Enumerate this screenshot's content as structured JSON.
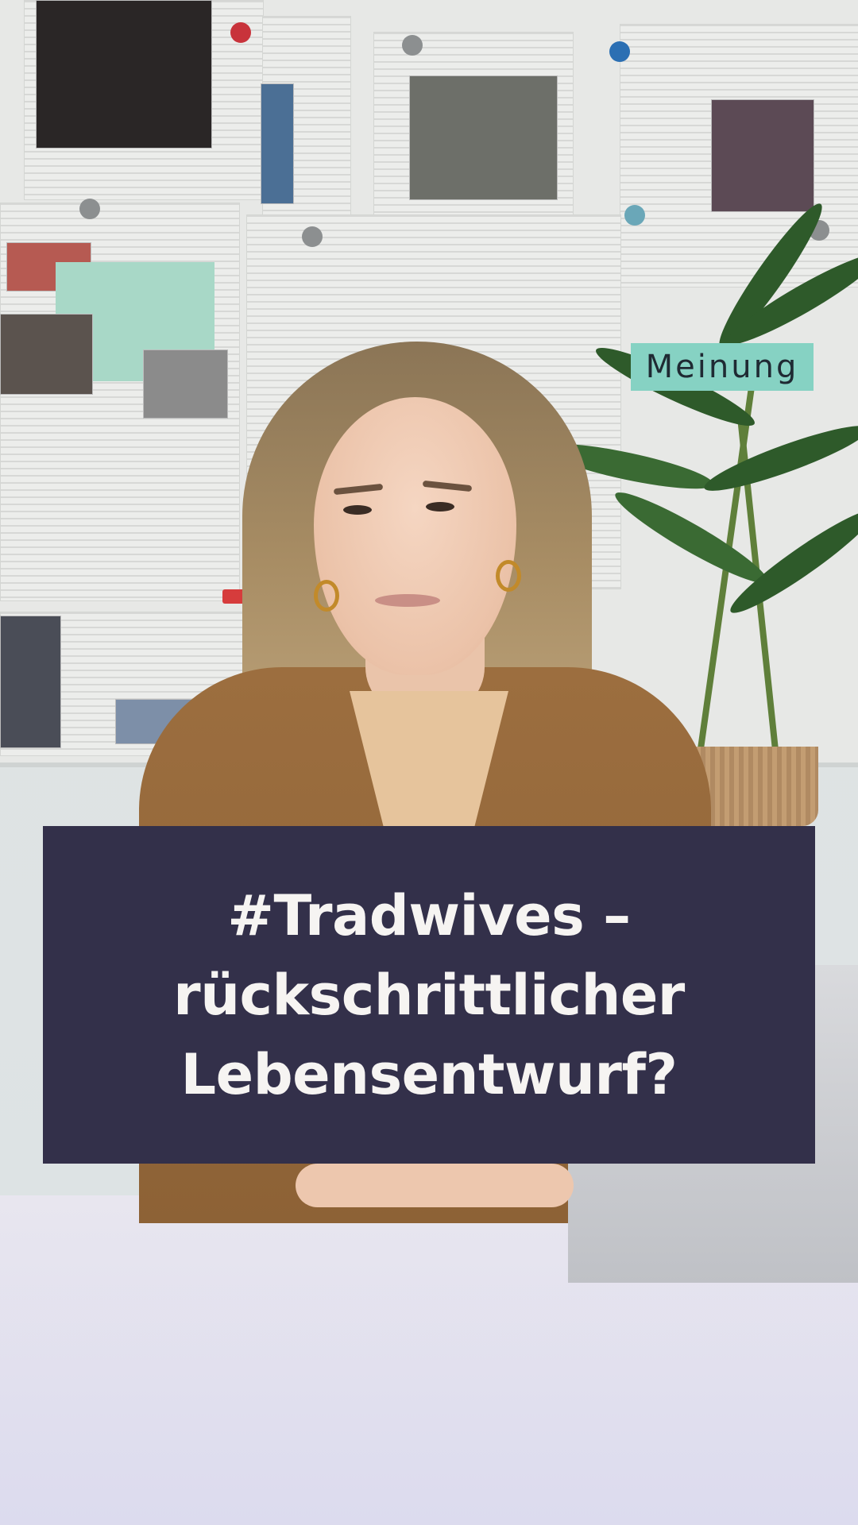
{
  "category": {
    "label": "Meinung"
  },
  "headline": {
    "lines": [
      "#Tradwives –",
      "rückschrittlicher",
      "Lebensentwurf?"
    ]
  },
  "colors": {
    "panel_background": "#33304a",
    "headline_text": "#f6f4f2",
    "badge_background": "#86d2c3",
    "badge_text": "#1f2a33"
  }
}
